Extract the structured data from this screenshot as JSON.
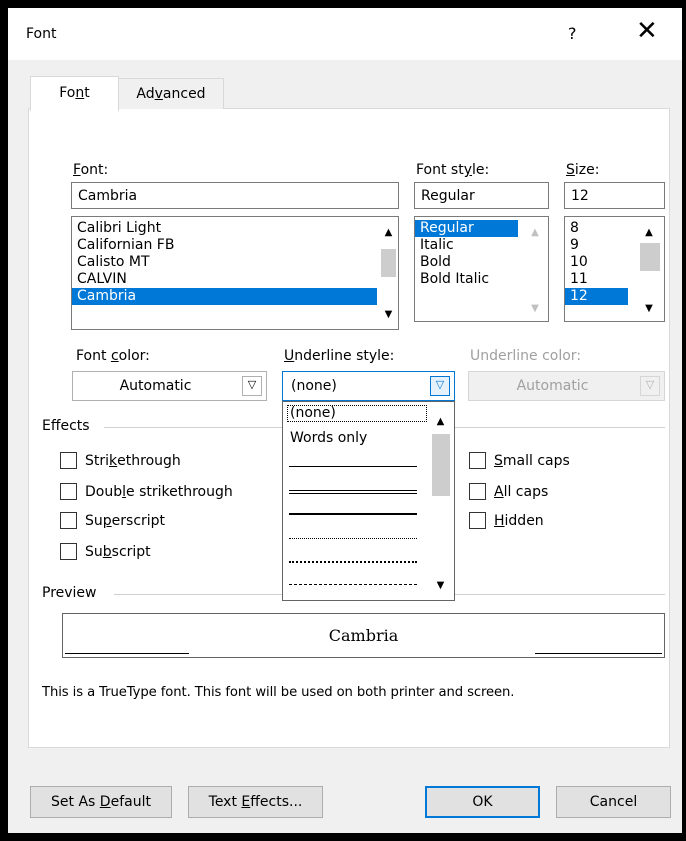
{
  "window": {
    "title": "Font",
    "help": "?",
    "close": "✕"
  },
  "tabs": [
    {
      "pre": "Fo",
      "ul": "n",
      "post": "t"
    },
    {
      "pre": "Ad",
      "ul": "v",
      "post": "anced"
    }
  ],
  "font": {
    "label_ul": "F",
    "label_rest": "ont:",
    "value": "Cambria",
    "items": [
      "Calibri Light",
      "Californian FB",
      "Calisto MT",
      "CALVIN",
      "Cambria"
    ],
    "selected": "Cambria"
  },
  "font_style": {
    "label_pre": "Font st",
    "label_ul": "y",
    "label_post": "le:",
    "value": "Regular",
    "items": [
      "Regular",
      "Italic",
      "Bold",
      "Bold Italic"
    ],
    "selected": "Regular"
  },
  "size": {
    "label_ul": "S",
    "label_rest": "ize:",
    "value": "12",
    "items": [
      "8",
      "9",
      "10",
      "11",
      "12"
    ],
    "selected": "12"
  },
  "font_color": {
    "label_pre": "Font ",
    "label_ul": "c",
    "label_post": "olor:",
    "value": "Automatic"
  },
  "underline_style": {
    "label_ul": "U",
    "label_rest": "nderline style:",
    "value": "(none)"
  },
  "underline_color": {
    "label": "Underline color:",
    "value": "Automatic"
  },
  "effects": {
    "heading": "Effects",
    "left": [
      {
        "pre": "Stri",
        "ul": "k",
        "post": "ethrough"
      },
      {
        "pre": "Doub",
        "ul": "l",
        "post": "e strikethrough"
      },
      {
        "pre": "Su",
        "ul": "p",
        "post": "erscript"
      },
      {
        "pre": "Su",
        "ul": "b",
        "post": "script"
      }
    ],
    "right": [
      {
        "pre": "",
        "ul": "S",
        "post": "mall caps"
      },
      {
        "pre": "",
        "ul": "A",
        "post": "ll caps"
      },
      {
        "pre": "",
        "ul": "H",
        "post": "idden"
      }
    ]
  },
  "underline_dropdown": {
    "items": [
      "(none)",
      "Words only"
    ],
    "line_styles": [
      "single",
      "double",
      "thick",
      "dotted",
      "dotted-heavy",
      "dashed"
    ]
  },
  "preview": {
    "heading": "Preview",
    "sample": "Cambria",
    "note": "This is a TrueType font. This font will be used on both printer and screen."
  },
  "buttons": {
    "set_default": {
      "pre": "Set As ",
      "ul": "D",
      "post": "efault"
    },
    "text_effects": {
      "pre": "Text ",
      "ul": "E",
      "post": "ffects..."
    },
    "ok": "OK",
    "cancel": "Cancel"
  },
  "colors": {
    "accent": "#0078d7",
    "frame": "#000000",
    "dialog_bg": "#f0f0f0"
  }
}
